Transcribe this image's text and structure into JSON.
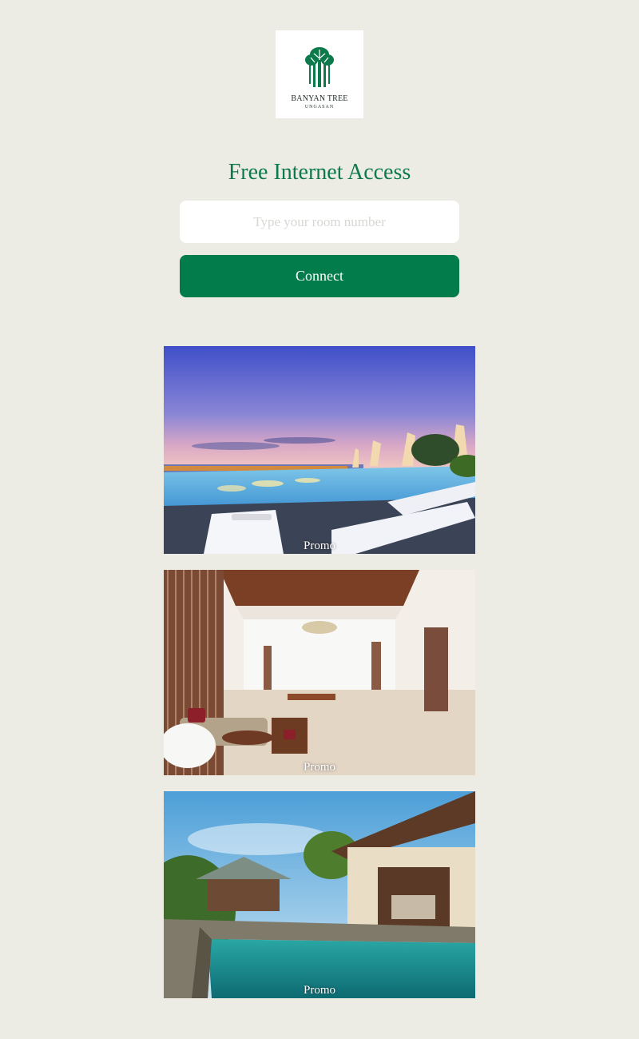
{
  "logo": {
    "icon": "banyan-tree-icon",
    "name": "BANYAN TREE",
    "sub": "UNGASAN",
    "color": "#0d7a4c"
  },
  "login": {
    "title": "Free Internet Access",
    "room_placeholder": "Type your room number",
    "connect_label": "Connect"
  },
  "promos": [
    {
      "label": "Promo",
      "image": "infinity-pool-at-dusk"
    },
    {
      "label": "Promo",
      "image": "resort-lobby"
    },
    {
      "label": "Promo",
      "image": "villa-with-private-pool"
    }
  ],
  "colors": {
    "background": "#ecebe4",
    "accent": "#027c4b",
    "title": "#0d7a4c"
  }
}
